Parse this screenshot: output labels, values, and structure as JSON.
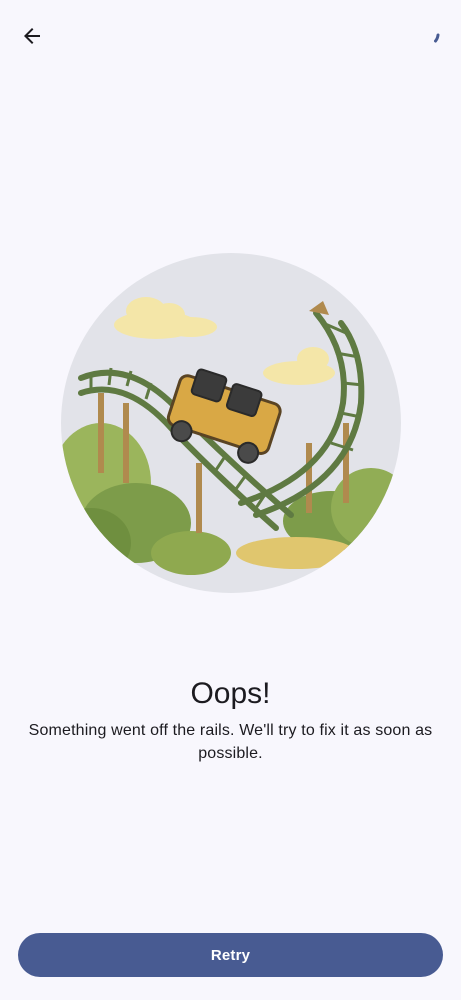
{
  "header": {
    "back_icon": "arrow-left-icon",
    "loading_icon": "circular-progress-icon"
  },
  "illustration": {
    "icon": "derailed-roller-coaster-illustration"
  },
  "error": {
    "title": "Oops!",
    "message": "Something went off the rails. We'll try to fix it as soon as possible."
  },
  "actions": {
    "retry_label": "Retry"
  },
  "colors": {
    "background": "#f8f7fd",
    "primary": "#485b92",
    "on_primary": "#ffffff",
    "text": "#1c1b20",
    "illustration_bg": "#e2e3e9"
  }
}
